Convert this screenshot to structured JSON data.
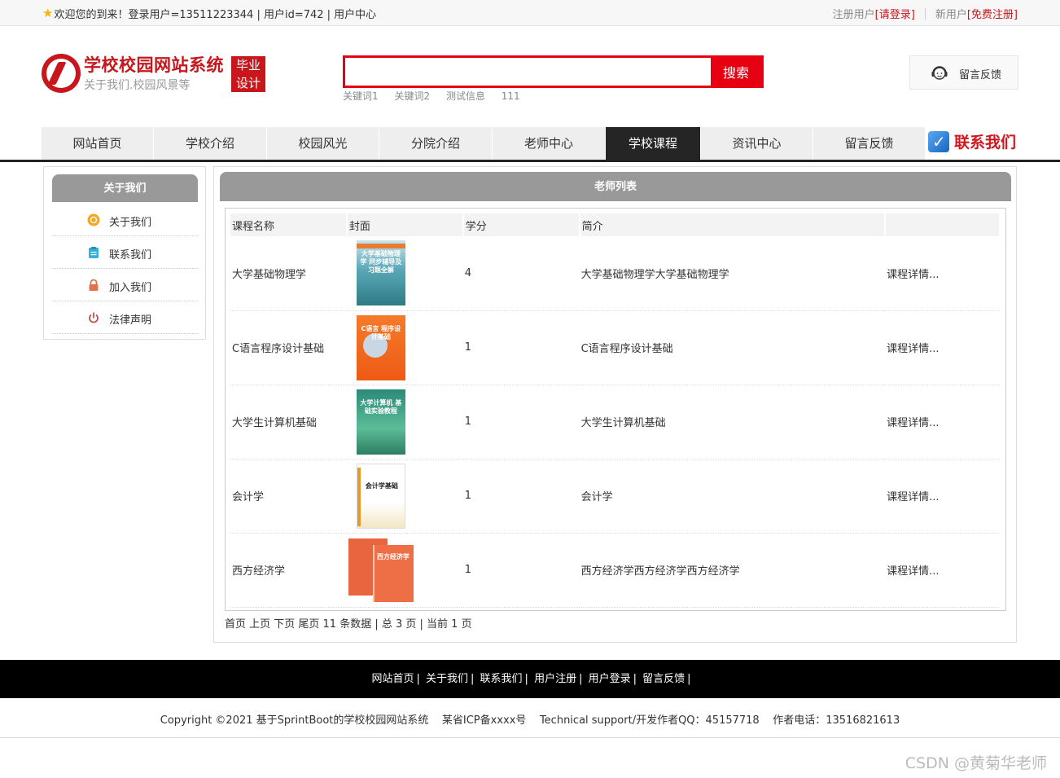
{
  "topbar": {
    "welcome": "欢迎您的到来！登录用户=13511223344 | 用户id=742 | 用户中心",
    "reg_text": "注册用户",
    "login_link": "[请登录]",
    "new_text": "新用户",
    "free_reg_link": "[免费注册]"
  },
  "header": {
    "title": "学校校园网站系统",
    "subtitle": "关于我们.校园风景等",
    "badge_line1": "毕业",
    "badge_line2": "设计",
    "search_placeholder": "",
    "search_button": "搜索",
    "hot_keywords": [
      "关键词1",
      "关键词2",
      "测试信息",
      "111"
    ],
    "feedback_label": "留言反馈"
  },
  "nav": {
    "items": [
      {
        "label": "网站首页",
        "active": false
      },
      {
        "label": "学校介绍",
        "active": false
      },
      {
        "label": "校园风光",
        "active": false
      },
      {
        "label": "分院介绍",
        "active": false
      },
      {
        "label": "老师中心",
        "active": false
      },
      {
        "label": "学校课程",
        "active": true
      },
      {
        "label": "资讯中心",
        "active": false
      },
      {
        "label": "留言反馈",
        "active": false
      }
    ],
    "contact_label": "联系我们"
  },
  "sidebar": {
    "title": "关于我们",
    "items": [
      {
        "label": "关于我们",
        "icon": "info-icon"
      },
      {
        "label": "联系我们",
        "icon": "clipboard-icon"
      },
      {
        "label": "加入我们",
        "icon": "lock-icon"
      },
      {
        "label": "法律声明",
        "icon": "power-icon"
      }
    ]
  },
  "main": {
    "title": "老师列表",
    "columns": [
      "课程名称",
      "封面",
      "学分",
      "简介",
      ""
    ],
    "rows": [
      {
        "name": "大学基础物理学",
        "cover_text": "大学基础物理学 同步辅导及习题全解",
        "credit": "4",
        "intro": "大学基础物理学大学基础物理学",
        "link": "课程详情..."
      },
      {
        "name": "C语言程序设计基础",
        "cover_text": "C语言 程序设计基础",
        "credit": "1",
        "intro": "C语言程序设计基础",
        "link": "课程详情..."
      },
      {
        "name": "大学生计算机基础",
        "cover_text": "大学计算机 基础实验教程",
        "credit": "1",
        "intro": "大学生计算机基础",
        "link": "课程详情..."
      },
      {
        "name": "会计学",
        "cover_text": "会计学基础",
        "credit": "1",
        "intro": "会计学",
        "link": "课程详情..."
      },
      {
        "name": "西方经济学",
        "cover_text": "西方经济学",
        "credit": "1",
        "intro": "西方经济学西方经济学西方经济学",
        "link": "课程详情..."
      }
    ],
    "pager": "首页 上页 下页 尾页 11 条数据 | 总 3 页 | 当前 1 页"
  },
  "footer": {
    "links": [
      "网站首页",
      "关于我们",
      "联系我们",
      "用户注册",
      "用户登录",
      "留言反馈"
    ],
    "copyright": "Copyright ©2021 基于SprintBoot的学校校园网站系统    某省ICP备xxxx号    Technical support/开发作者QQ：45157718    作者电话：13516821613",
    "watermark": "CSDN @黄菊华老师"
  },
  "colors": {
    "brand_red": "#c8161d",
    "search_red": "#e60012",
    "nav_active": "#252525",
    "panel_gray": "#999999"
  }
}
